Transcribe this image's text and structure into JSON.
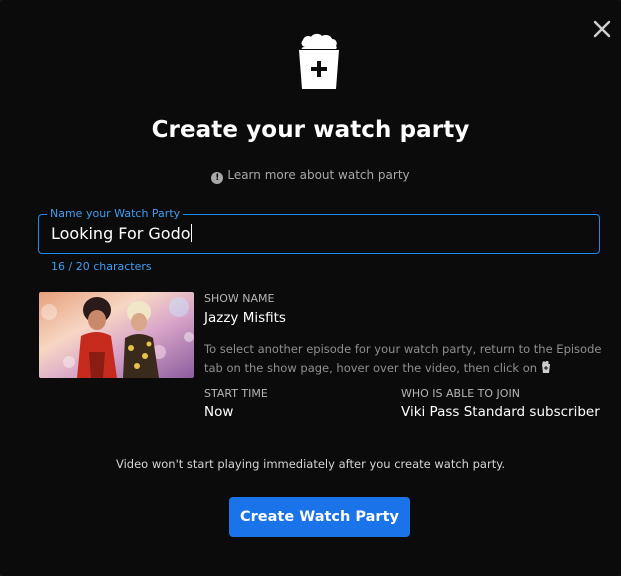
{
  "dialog": {
    "title": "Create your watch party",
    "learn_more": "Learn more about watch party",
    "close_icon": "close-icon"
  },
  "name_field": {
    "label": "Name your Watch Party",
    "value": "Looking For Godo",
    "char_count": "16 / 20 characters"
  },
  "show": {
    "name_label": "SHOW NAME",
    "name": "Jazzy Misfits",
    "description": "To select another episode for your watch party, return to the Episode tab on the show page, hover over the video, then click on",
    "start_time_label": "START TIME",
    "start_time": "Now",
    "who_label": "WHO IS ABLE TO JOIN",
    "who": "Viki Pass Standard subscriber"
  },
  "notice": "Video won't start playing immediately after you create watch party.",
  "create_button": "Create Watch Party",
  "colors": {
    "accent": "#1a73e8",
    "field_border": "#1e8cf0",
    "background": "#0b0b0b"
  }
}
